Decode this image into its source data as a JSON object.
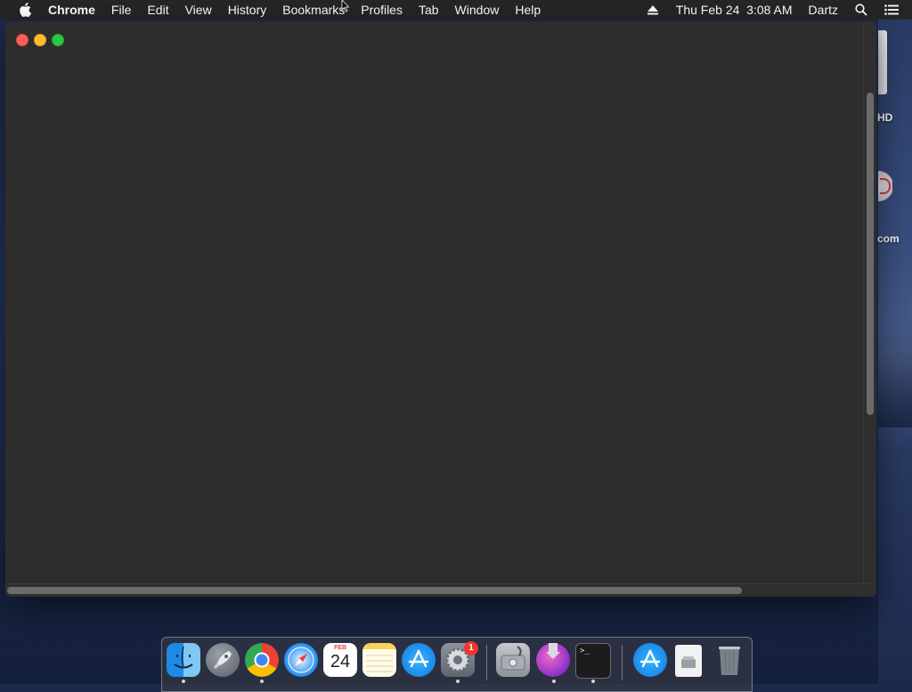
{
  "menubar": {
    "app_name": "Chrome",
    "items": [
      "File",
      "Edit",
      "View",
      "History",
      "Bookmarks",
      "Profiles",
      "Tab",
      "Window",
      "Help"
    ],
    "datetime": "Thu Feb 24  3:08 AM",
    "user": "Dartz"
  },
  "desktop": {
    "labels": [
      "HD",
      "com"
    ]
  },
  "dock": {
    "calendar_month": "FEB",
    "calendar_day": "24",
    "settings_badge": "1",
    "terminal_prompt": ">_"
  },
  "colors": {
    "close": "#fc5f57",
    "minimize": "#fdbc2e",
    "maximize": "#28c840",
    "window_bg": "#2d2d2e",
    "menubar_bg": "#262628"
  }
}
